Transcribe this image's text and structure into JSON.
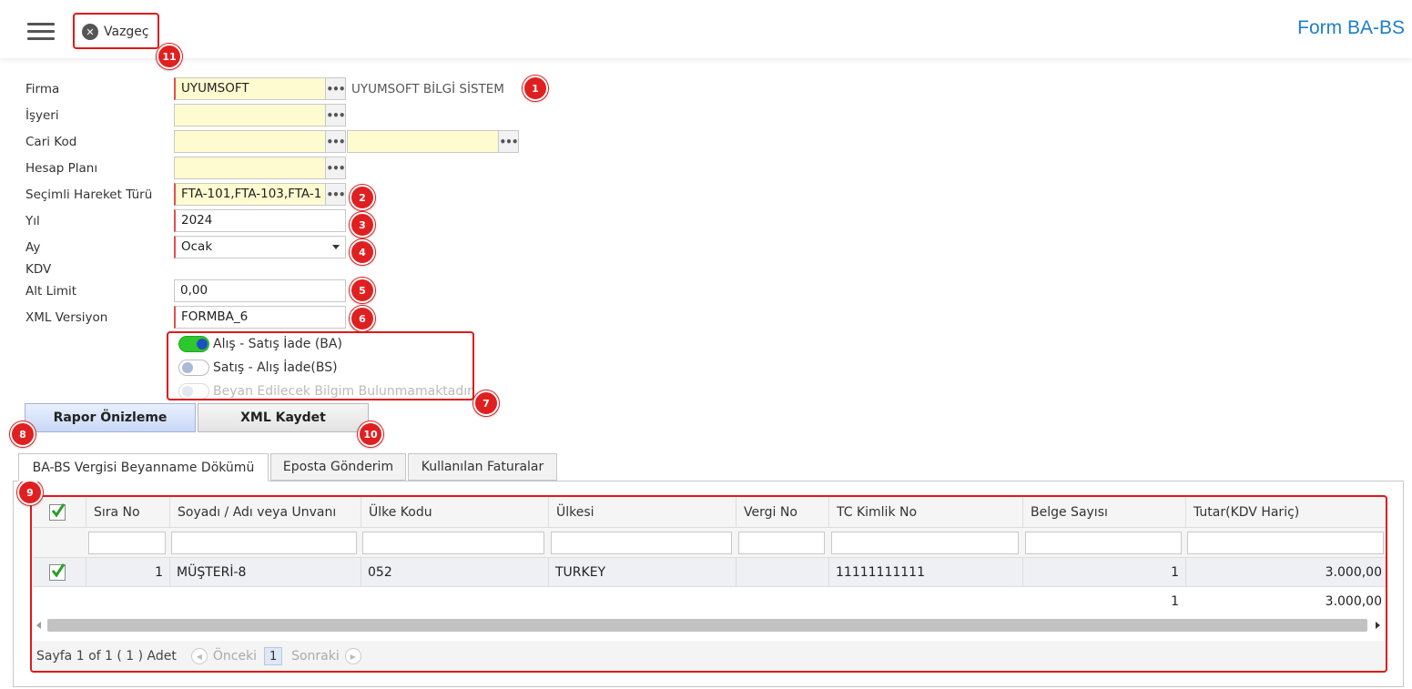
{
  "toolbar": {
    "cancel_label": "Vazgeç"
  },
  "form_title": "Form BA-BS",
  "form": {
    "firma": {
      "label": "Firma",
      "value": "UYUMSOFT",
      "description": "UYUMSOFT BİLGİ SİSTEM"
    },
    "isyeri": {
      "label": "İşyeri",
      "value": ""
    },
    "cari_kod": {
      "label": "Cari Kod",
      "value": "",
      "value2": ""
    },
    "hesap_plani": {
      "label": "Hesap Planı",
      "value": ""
    },
    "hareket_turu": {
      "label": "Seçimli Hareket Türü",
      "value": "FTA-101,FTA-103,FTA-1"
    },
    "yil": {
      "label": "Yıl",
      "value": "2024"
    },
    "ay": {
      "label": "Ay",
      "value": "Ocak"
    },
    "kdv": {
      "label": "KDV"
    },
    "alt_limit": {
      "label": "Alt Limit",
      "value": "0,00"
    },
    "xml_versiyon": {
      "label": "XML Versiyon",
      "value": "FORMBA_6"
    }
  },
  "toggles": [
    {
      "label": "Alış - Satış İade (BA)",
      "state": "on"
    },
    {
      "label": "Satış - Alış İade(BS)",
      "state": "off"
    },
    {
      "label": "Beyan Edilecek Bilgim Bulunmamaktadır",
      "state": "disabled"
    }
  ],
  "buttons": {
    "preview": "Rapor Önizleme",
    "save_xml": "XML Kaydet"
  },
  "tabs": [
    "BA-BS Vergisi Beyanname Dökümü",
    "Eposta Gönderim",
    "Kullanılan Faturalar"
  ],
  "grid": {
    "columns": [
      "Sıra No",
      "Soyadı / Adı veya Unvanı",
      "Ülke Kodu",
      "Ülkesi",
      "Vergi No",
      "TC Kimlik No",
      "Belge Sayısı",
      "Tutar(KDV Hariç)"
    ],
    "rows": [
      {
        "checked": true,
        "sira_no": "1",
        "unvan": "MÜŞTERİ-8",
        "ulke_kodu": "052",
        "ulkesi": "TURKEY",
        "vergi_no": "",
        "tc_kimlik": "11111111111",
        "belge_sayisi": "1",
        "tutar": "3.000,00"
      }
    ],
    "summary": {
      "belge_sayisi": "1",
      "tutar": "3.000,00"
    }
  },
  "pager": {
    "info": "Sayfa 1 of 1 ( 1 ) Adet",
    "prev": "Önceki",
    "page": "1",
    "next": "Sonraki"
  },
  "markers": [
    "1",
    "2",
    "3",
    "4",
    "5",
    "6",
    "7",
    "8",
    "9",
    "10",
    "11"
  ],
  "colors": {
    "accent": "#1e7fc6",
    "highlight": "#e01818",
    "required_field": "#fffbd0",
    "toggle_on": "#2ec82e"
  }
}
